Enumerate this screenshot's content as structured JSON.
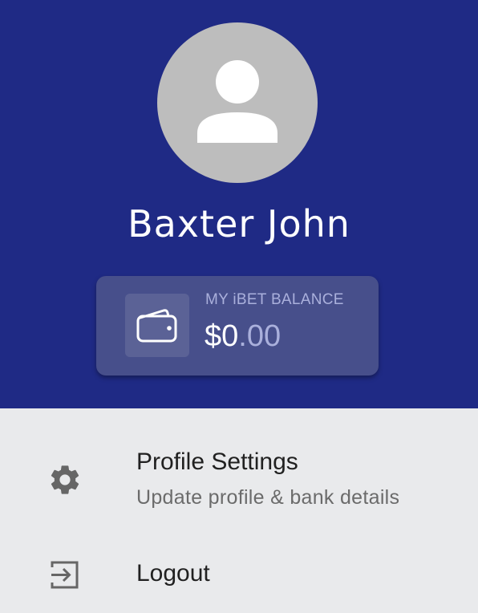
{
  "profile": {
    "name": "Baxter John",
    "avatar_icon": "person-placeholder-icon"
  },
  "balance": {
    "label": "MY iBET BALANCE",
    "amount_main": "$0",
    "amount_cents": ".00",
    "icon": "wallet-icon"
  },
  "menu": {
    "items": [
      {
        "icon": "gear-icon",
        "title": "Profile Settings",
        "subtitle": "Update profile & bank details"
      },
      {
        "icon": "logout-icon",
        "title": "Logout"
      }
    ]
  },
  "colors": {
    "header_bg": "#1f2a85",
    "card_bg": "#474f8b",
    "page_bg": "#e9eaec",
    "accent_text": "#aab0dc"
  }
}
